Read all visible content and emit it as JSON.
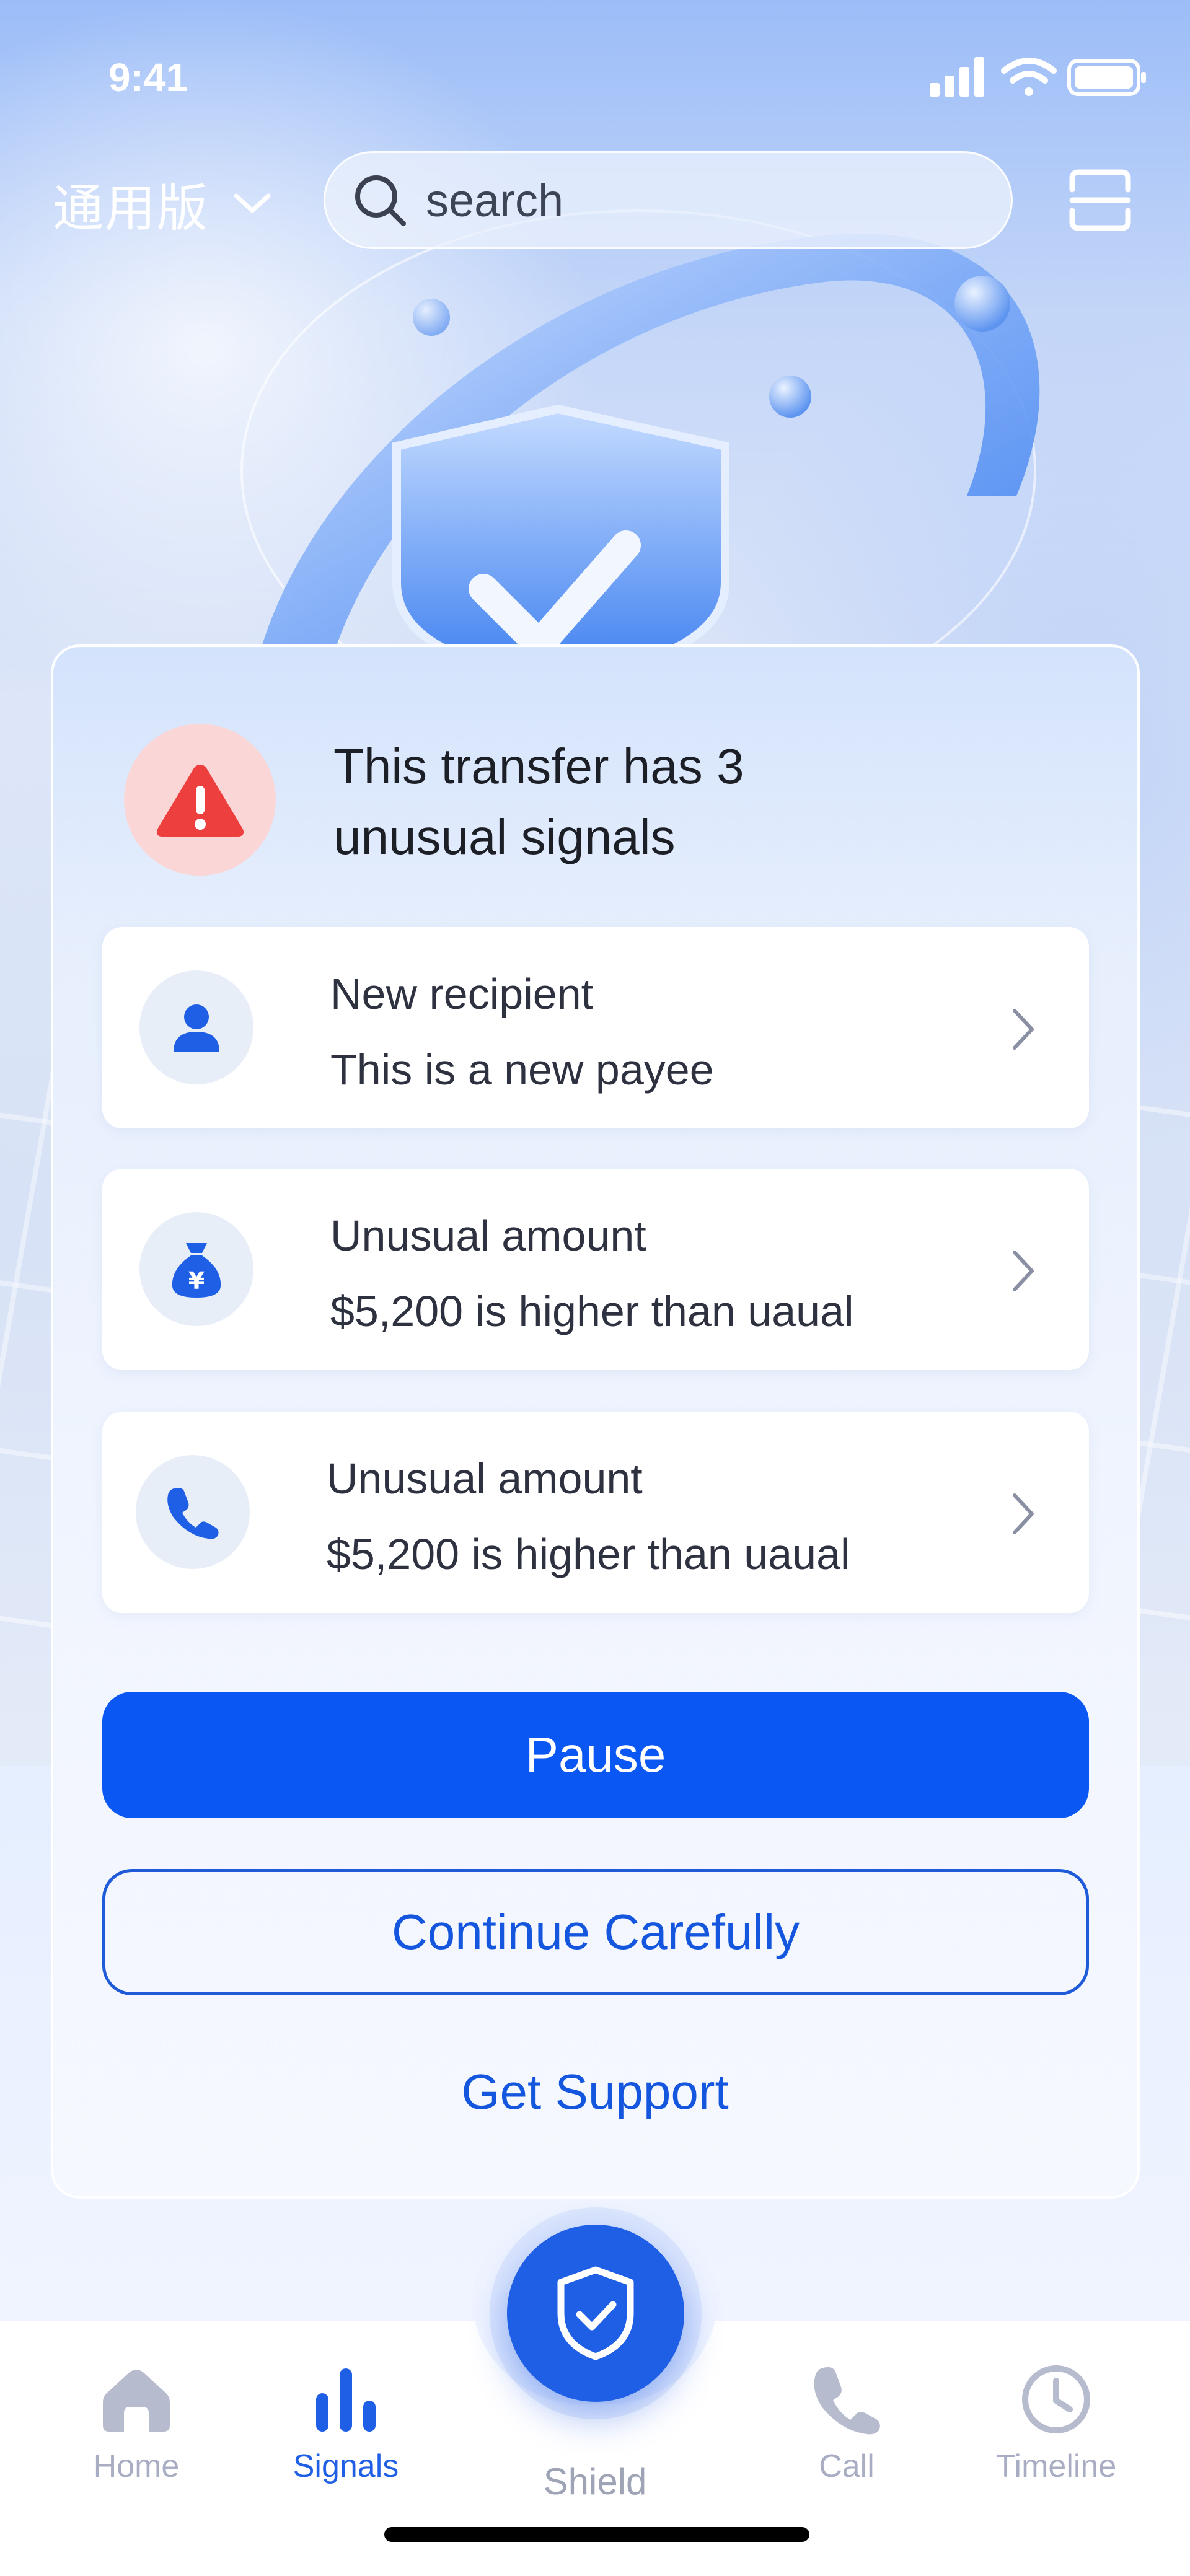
{
  "status_bar": {
    "time": "9:41",
    "icons": [
      "signal-bars-icon",
      "wifi-icon",
      "battery-icon"
    ]
  },
  "header": {
    "version_label": "通用版",
    "search_placeholder": "search"
  },
  "warning": {
    "title_line1": "This transfer has 3",
    "title_line2": "unusual signals",
    "signals": [
      {
        "icon": "person-icon",
        "title": "New recipient",
        "description": "This is a new payee"
      },
      {
        "icon": "money-bag-icon",
        "title": "Unusual amount",
        "description": "$5,200 is higher than uaual"
      },
      {
        "icon": "phone-icon",
        "title": "Unusual amount",
        "description": "$5,200 is higher than uaual"
      }
    ],
    "pause_label": "Pause",
    "continue_label": "Continue Carefully",
    "support_label": "Get Support"
  },
  "tabbar": {
    "items": [
      {
        "label": "Home",
        "active": false
      },
      {
        "label": "Signals",
        "active": true
      },
      {
        "label": "Shield",
        "active": false
      },
      {
        "label": "Call",
        "active": false
      },
      {
        "label": "Timeline",
        "active": false
      }
    ]
  },
  "colors": {
    "primary": "#0b57f4",
    "accent_text": "#1457de",
    "alert_red": "#ee3f3f",
    "alert_bg": "#fbd6d6",
    "tab_inactive": "#a8adc3"
  }
}
